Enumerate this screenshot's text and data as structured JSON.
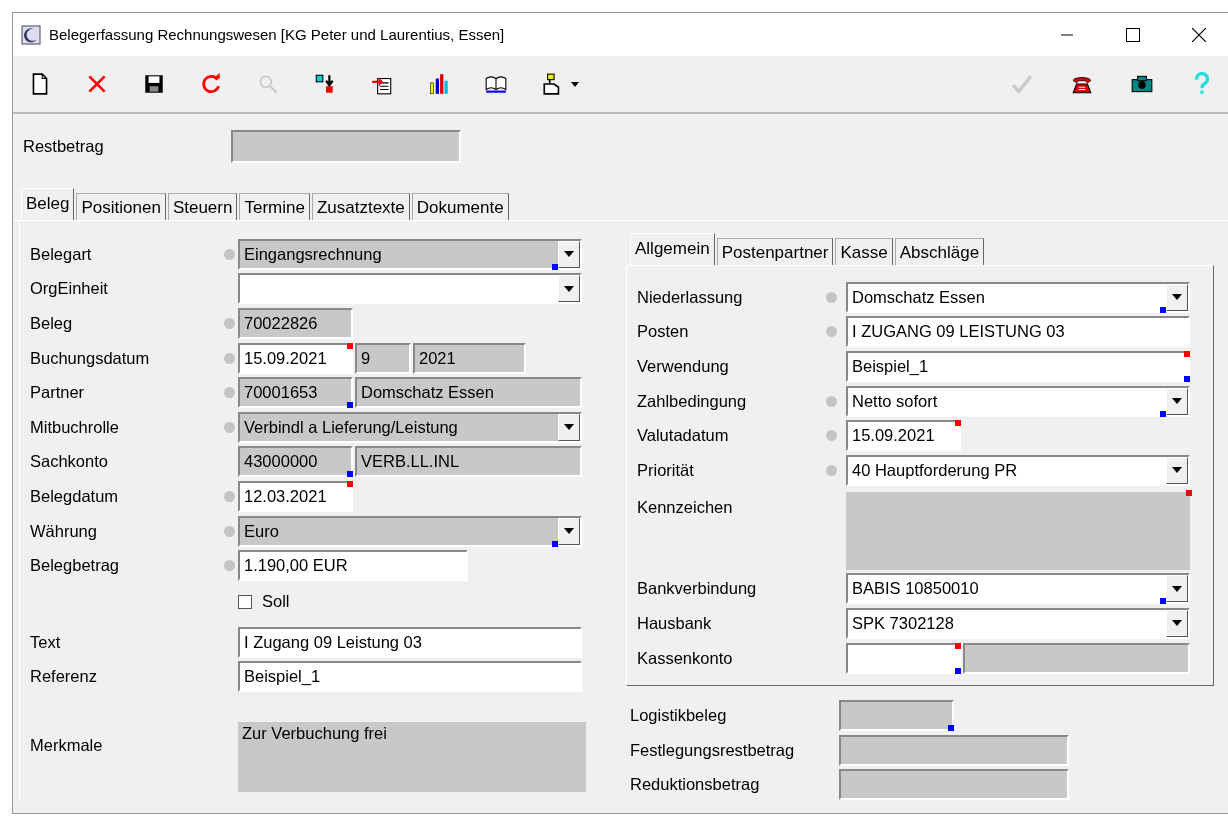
{
  "window": {
    "title": "Belegerfassung Rechnungswesen [KG Peter und Laurentius, Essen]"
  },
  "toolbar": {
    "left": [
      {
        "kind": "new",
        "disabled": false,
        "menu": false
      },
      {
        "kind": "delete",
        "disabled": false,
        "menu": false
      },
      {
        "kind": "save",
        "disabled": false,
        "menu": false
      },
      {
        "kind": "refresh",
        "disabled": false,
        "menu": false
      },
      {
        "kind": "search",
        "disabled": true,
        "menu": false
      },
      {
        "kind": "transfer",
        "disabled": false,
        "menu": false
      },
      {
        "kind": "import",
        "disabled": false,
        "menu": false
      },
      {
        "kind": "chart",
        "disabled": false,
        "menu": false
      },
      {
        "kind": "book",
        "disabled": false,
        "menu": false
      },
      {
        "kind": "stamp",
        "disabled": false,
        "menu": true
      }
    ],
    "right": [
      {
        "kind": "confirm",
        "disabled": true,
        "menu": false
      },
      {
        "kind": "phone",
        "disabled": false,
        "menu": false
      },
      {
        "kind": "camera",
        "disabled": false,
        "menu": false
      },
      {
        "kind": "help",
        "disabled": false,
        "menu": false
      }
    ]
  },
  "restbetrag": {
    "label": "Restbetrag"
  },
  "tabs": [
    {
      "label": "Beleg",
      "selected": true
    },
    {
      "label": "Positionen",
      "selected": false
    },
    {
      "label": "Steuern",
      "selected": false
    },
    {
      "label": "Termine",
      "selected": false
    },
    {
      "label": "Zusatztexte",
      "selected": false
    },
    {
      "label": "Dokumente",
      "selected": false
    }
  ],
  "left": {
    "rows": [
      {
        "label": "Belegart",
        "required": true,
        "fields": [
          {
            "kind": "combo",
            "value": "Eingangsrechnung",
            "editable": false,
            "bottom_marker": true
          }
        ]
      },
      {
        "label": "OrgEinheit",
        "required": false,
        "fields": [
          {
            "kind": "combo",
            "editable": true
          }
        ]
      },
      {
        "label": "Beleg",
        "required": true,
        "fields": [
          {
            "kind": "code",
            "value": "70022826",
            "editable": false
          }
        ]
      },
      {
        "label": "Buchungsdatum",
        "required": true,
        "fields": [
          {
            "kind": "code",
            "value": "15.09.2021",
            "editable": true,
            "top_marker": true
          },
          {
            "kind": "period",
            "value": "9",
            "editable": false
          },
          {
            "kind": "year",
            "value": "2021",
            "editable": false
          }
        ]
      },
      {
        "label": "Partner",
        "required": true,
        "fields": [
          {
            "kind": "code",
            "value": "70001653",
            "editable": false,
            "bottom_marker": true
          },
          {
            "kind": "text",
            "value": "Domschatz Essen",
            "editable": false
          }
        ]
      },
      {
        "label": "Mitbuchrolle",
        "required": true,
        "fields": [
          {
            "kind": "combo",
            "value": "Verbindl a Lieferung/Leistung",
            "editable": false
          }
        ]
      },
      {
        "label": "Sachkonto",
        "required": false,
        "fields": [
          {
            "kind": "code",
            "value": "43000000",
            "editable": false,
            "bottom_marker": true
          },
          {
            "kind": "text",
            "value": "VERB.LL.INL",
            "editable": false
          }
        ]
      },
      {
        "label": "Belegdatum",
        "required": true,
        "fields": [
          {
            "kind": "code",
            "value": "12.03.2021",
            "editable": true,
            "top_marker": true
          }
        ]
      },
      {
        "label": "Währung",
        "required": true,
        "fields": [
          {
            "kind": "combo",
            "value": "Euro",
            "editable": false,
            "bottom_marker": true
          }
        ]
      },
      {
        "label": "Belegbetrag",
        "required": true,
        "fields": [
          {
            "kind": "amount",
            "value": "1.190,00 EUR",
            "editable": true
          }
        ]
      }
    ],
    "soll": {
      "label": "Soll",
      "checked": false
    },
    "text_rows": [
      {
        "label": "Text",
        "required": false,
        "fields": [
          {
            "kind": "text",
            "value": "I Zugang 09 Leistung 03",
            "editable": true
          }
        ]
      },
      {
        "label": "Referenz",
        "required": false,
        "fields": [
          {
            "kind": "text",
            "value": "Beispiel_1",
            "editable": true
          }
        ]
      }
    ],
    "merkmale": {
      "label": "Merkmale",
      "value": "Zur Verbuchung frei"
    }
  },
  "subtabs": [
    {
      "label": "Allgemein",
      "selected": true
    },
    {
      "label": "Postenpartner",
      "selected": false
    },
    {
      "label": "Kasse",
      "selected": false
    },
    {
      "label": "Abschläge",
      "selected": false
    }
  ],
  "right": {
    "rows": [
      {
        "label": "Niederlassung",
        "required": true,
        "fields": [
          {
            "kind": "combo",
            "value": "Domschatz Essen",
            "editable": true,
            "bottom_marker": true
          }
        ]
      },
      {
        "label": "Posten",
        "required": true,
        "fields": [
          {
            "kind": "text",
            "value": "I ZUGANG 09 LEISTUNG 03",
            "editable": true
          }
        ]
      },
      {
        "label": "Verwendung",
        "required": false,
        "fields": [
          {
            "kind": "text",
            "value": "Beispiel_1",
            "editable": true,
            "top_marker": true,
            "bottom_marker": true
          }
        ]
      },
      {
        "label": "Zahlbedingung",
        "required": true,
        "fields": [
          {
            "kind": "combo",
            "value": "Netto sofort",
            "editable": true,
            "bottom_marker": true
          }
        ]
      },
      {
        "label": "Valutadatum",
        "required": true,
        "fields": [
          {
            "kind": "code",
            "value": "15.09.2021",
            "editable": true,
            "top_marker": true
          }
        ]
      },
      {
        "label": "Priorität",
        "required": true,
        "fields": [
          {
            "kind": "combo",
            "value": "40 Hauptforderung PR",
            "editable": true
          }
        ]
      },
      {
        "label": "Kennzeichen",
        "required": false,
        "fields": [
          {
            "kind": "area",
            "editable": false,
            "top_marker": true
          }
        ]
      },
      {
        "label": "Bankverbindung",
        "required": false,
        "fields": [
          {
            "kind": "combo",
            "value": "BABIS 10850010",
            "editable": true,
            "bottom_marker": true
          }
        ]
      },
      {
        "label": "Hausbank",
        "required": false,
        "fields": [
          {
            "kind": "combo",
            "value": "SPK 7302128",
            "editable": true
          }
        ]
      },
      {
        "label": "Kassenkonto",
        "required": false,
        "fields": [
          {
            "kind": "code",
            "editable": true,
            "top_marker": true,
            "bottom_marker": true
          },
          {
            "kind": "text",
            "editable": false
          }
        ]
      }
    ],
    "footer_rows": [
      {
        "label": "Logistikbeleg",
        "required": false,
        "fields": [
          {
            "kind": "code",
            "editable": false,
            "bottom_marker": true
          }
        ]
      },
      {
        "label": "Festlegungsrestbetrag",
        "required": false,
        "fields": [
          {
            "kind": "amount",
            "editable": false
          }
        ]
      },
      {
        "label": "Reduktionsbetrag",
        "required": false,
        "fields": [
          {
            "kind": "amount",
            "editable": false
          }
        ]
      }
    ]
  }
}
